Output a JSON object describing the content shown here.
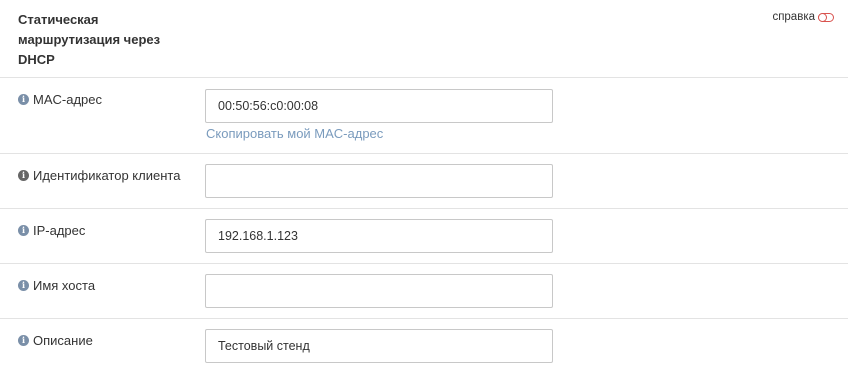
{
  "section": {
    "title": "Статическая маршрутизация через DHCP",
    "help_label": "справка"
  },
  "fields": {
    "mac": {
      "label": "MAC-адрес",
      "value": "00:50:56:c0:00:08",
      "link": "Скопировать мой MAC-адрес"
    },
    "client_id": {
      "label": "Идентификатор клиента",
      "value": ""
    },
    "ip": {
      "label": "IP-адрес",
      "value": "192.168.1.123"
    },
    "hostname": {
      "label": "Имя хоста",
      "value": ""
    },
    "description": {
      "label": "Описание",
      "value": "Тестовый стенд"
    }
  },
  "icons": {
    "info": "info-icon",
    "help_toggle": "toggle-icon"
  },
  "colors": {
    "accent_link": "#7a9bbd",
    "toggle": "#d9534f",
    "border": "#c8c8c8"
  }
}
